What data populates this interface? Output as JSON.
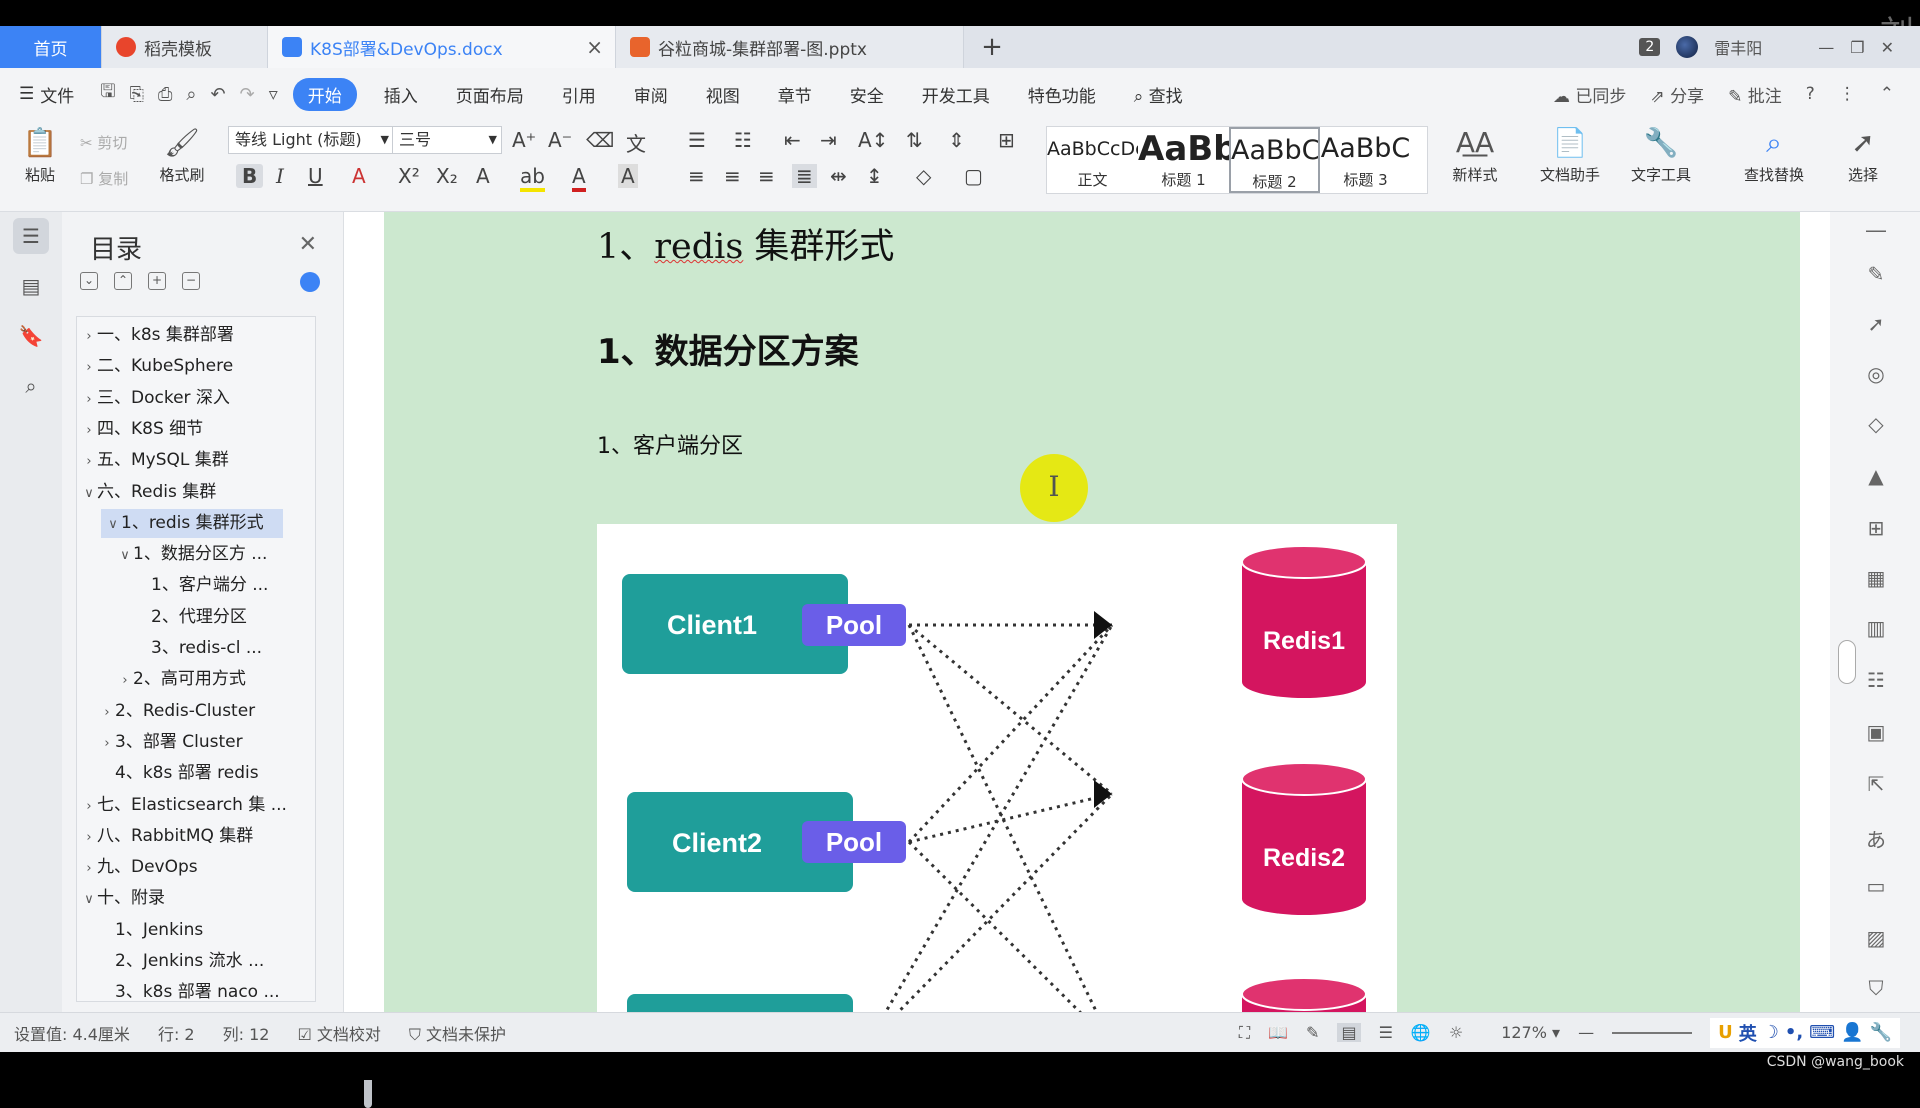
{
  "tabs": [
    {
      "label": "首页"
    },
    {
      "label": "稻壳模板"
    },
    {
      "label": "K8S部署&DevOps.docx"
    },
    {
      "label": "谷粒商城-集群部署-图.pptx"
    }
  ],
  "header_right": {
    "badge": "2",
    "user": "雷丰阳",
    "watermark": "刘"
  },
  "menu": {
    "file": "文件",
    "items": [
      "开始",
      "插入",
      "页面布局",
      "引用",
      "审阅",
      "视图",
      "章节",
      "安全",
      "开发工具",
      "特色功能"
    ],
    "search": "查找",
    "synced": "已同步",
    "share": "分享",
    "comment": "批注"
  },
  "ribbon": {
    "paste": "粘贴",
    "cut": "剪切",
    "copy": "复制",
    "format_painter": "格式刷",
    "font_name": "等线 Light (标题)",
    "font_size": "三号",
    "styles": [
      {
        "preview": "AaBbCcDc",
        "label": "正文"
      },
      {
        "preview": "AaBb",
        "label": "标题 1"
      },
      {
        "preview": "AaBbC",
        "label": "标题 2"
      },
      {
        "preview": "AaBbC",
        "label": "标题 3"
      }
    ],
    "new_style": "新样式",
    "doc_helper": "文档助手",
    "text_tools": "文字工具",
    "find_replace": "查找替换",
    "select": "选择"
  },
  "toc": {
    "title": "目录",
    "items": [
      {
        "label": "一、k8s 集群部署",
        "level": 0,
        "arrow": "right"
      },
      {
        "label": "二、KubeSphere",
        "level": 0,
        "arrow": "right"
      },
      {
        "label": "三、Docker 深入",
        "level": 0,
        "arrow": "right"
      },
      {
        "label": "四、K8S 细节",
        "level": 0,
        "arrow": "right"
      },
      {
        "label": "五、MySQL 集群",
        "level": 0,
        "arrow": "right"
      },
      {
        "label": "六、Redis 集群",
        "level": 0,
        "arrow": "down"
      },
      {
        "label": "1、redis 集群形式",
        "level": 1,
        "arrow": "down",
        "active": true
      },
      {
        "label": "1、数据分区方 ...",
        "level": 2,
        "arrow": "down"
      },
      {
        "label": "1、客户端分 ...",
        "level": 3,
        "arrow": ""
      },
      {
        "label": "2、代理分区",
        "level": 3,
        "arrow": ""
      },
      {
        "label": "3、redis-cl ...",
        "level": 3,
        "arrow": ""
      },
      {
        "label": "2、高可用方式",
        "level": 2,
        "arrow": "right"
      },
      {
        "label": "2、Redis-Cluster",
        "level": 1,
        "arrow": "right"
      },
      {
        "label": "3、部署 Cluster",
        "level": 1,
        "arrow": "right"
      },
      {
        "label": "4、k8s 部署 redis",
        "level": 1,
        "arrow": ""
      },
      {
        "label": "七、Elasticsearch 集 ...",
        "level": 0,
        "arrow": "right"
      },
      {
        "label": "八、RabbitMQ 集群",
        "level": 0,
        "arrow": "right"
      },
      {
        "label": "九、DevOps",
        "level": 0,
        "arrow": "right"
      },
      {
        "label": "十、附录",
        "level": 0,
        "arrow": "down"
      },
      {
        "label": "1、Jenkins",
        "level": 1,
        "arrow": ""
      },
      {
        "label": "2、Jenkins 流水 ...",
        "level": 1,
        "arrow": ""
      },
      {
        "label": "3、k8s 部署 naco ...",
        "level": 1,
        "arrow": ""
      }
    ]
  },
  "document": {
    "h1_num": "1、",
    "h1_word": "redis",
    "h1_rest": " 集群形式",
    "h2": "1、数据分区方案",
    "h3": "1、客户端分区",
    "cursor_glyph": "I"
  },
  "figure": {
    "clients": [
      "Client1",
      "Client2"
    ],
    "pool": "Pool",
    "redis": [
      "Redis1",
      "Redis2"
    ],
    "client_color": "#1f9e9a",
    "pool_color": "#6a5ee8",
    "redis_color": "#d4155f"
  },
  "status": {
    "setting": "设置值: 4.4厘米",
    "row": "行: 2",
    "col": "列: 12",
    "proofread": "文档校对",
    "protect": "文档未保护",
    "zoom": "127%",
    "ime": "英"
  },
  "footer": {
    "credit": "CSDN @wang_book"
  }
}
